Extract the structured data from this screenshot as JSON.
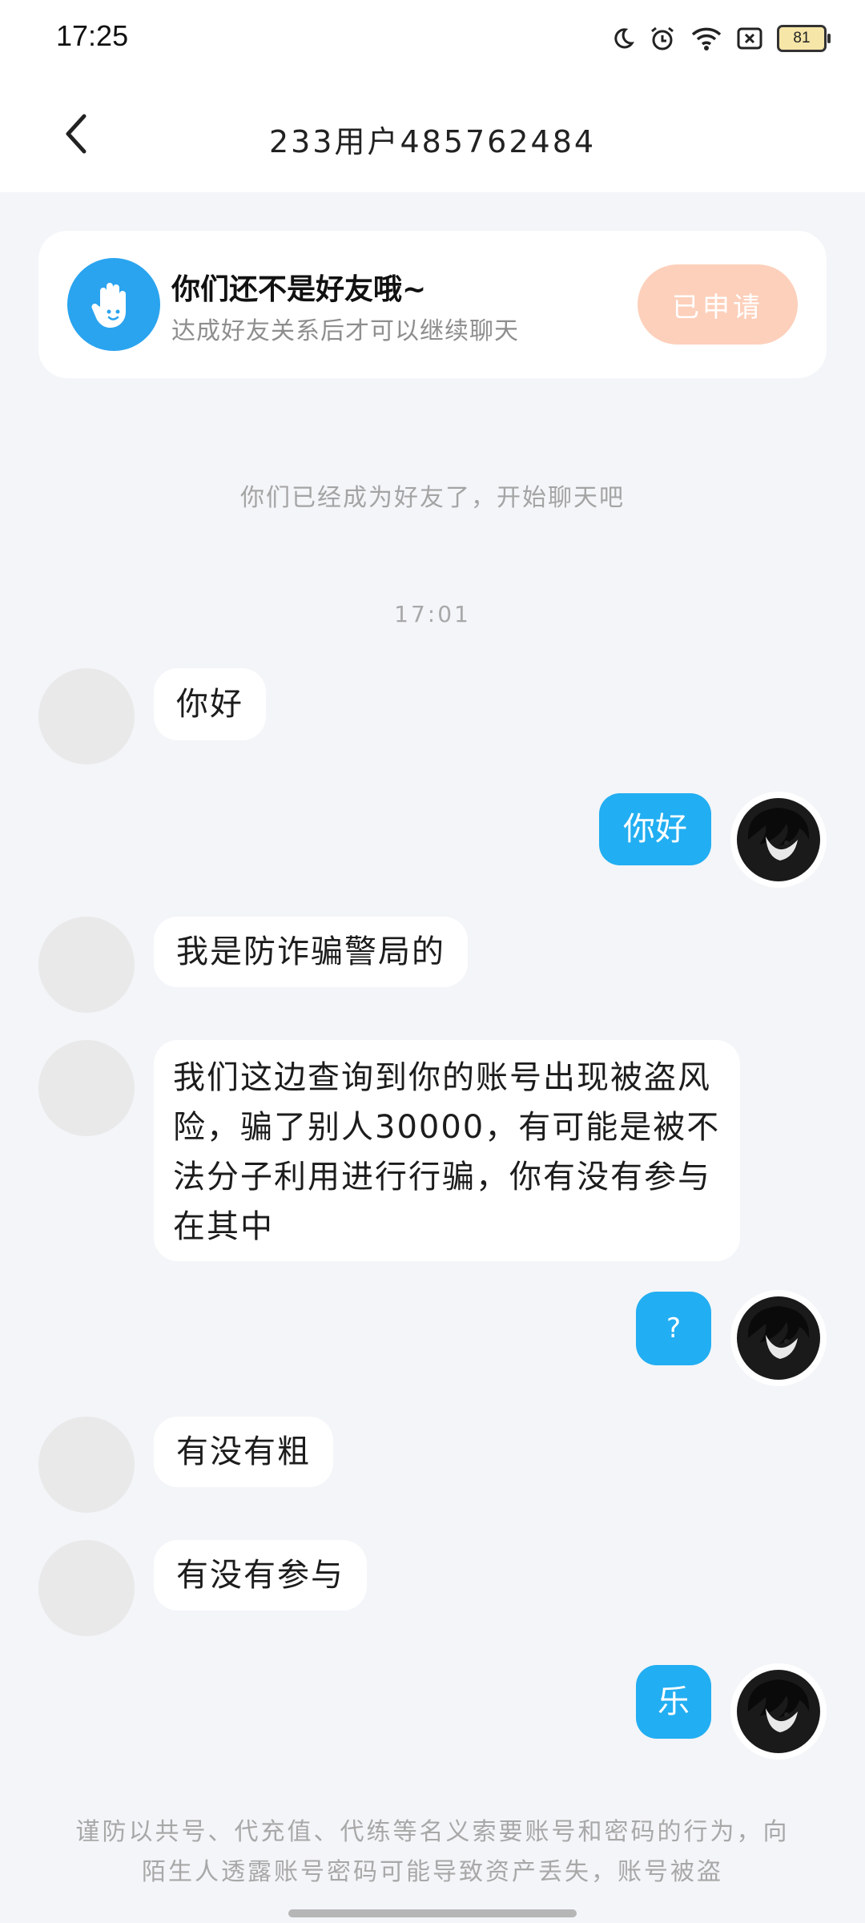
{
  "status_bar": {
    "time": "17:25",
    "battery": "81",
    "icons": [
      "moon-icon",
      "alarm-icon",
      "wifi-icon",
      "sim-off-icon",
      "battery-icon"
    ]
  },
  "header": {
    "title": "233用户485762484",
    "back_icon": "chevron-left-icon"
  },
  "friend_banner": {
    "title": "你们还不是好友哦~",
    "subtitle": "达成好友关系后才可以继续聊天",
    "button_label": "已申请",
    "button_color": "#fdd0bb",
    "avatar_icon": "hand-icon",
    "avatar_color": "#2aa4ef"
  },
  "system_message": "你们已经成为好友了，开始聊天吧",
  "timestamp": "17:01",
  "messages": [
    {
      "side": "left",
      "text": "你好"
    },
    {
      "side": "right",
      "text": "你好"
    },
    {
      "side": "left",
      "text": "我是防诈骗警局的"
    },
    {
      "side": "left",
      "text": "我们这边查询到你的账号出现被盗风险，骗了别人30000，有可能是被不法分子利用进行行骗，你有没有参与在其中"
    },
    {
      "side": "right",
      "text": "?"
    },
    {
      "side": "left",
      "text": "有没有粗"
    },
    {
      "side": "left",
      "text": "有没有参与"
    },
    {
      "side": "right",
      "text": "乐"
    }
  ],
  "footer_notice": "谨防以共号、代充值、代练等名义索要账号和密码的行为，向陌生人透露账号密码可能导致资产丢失，账号被盗",
  "colors": {
    "accent_bubble": "#22aef2",
    "background": "#f3f5f8"
  }
}
